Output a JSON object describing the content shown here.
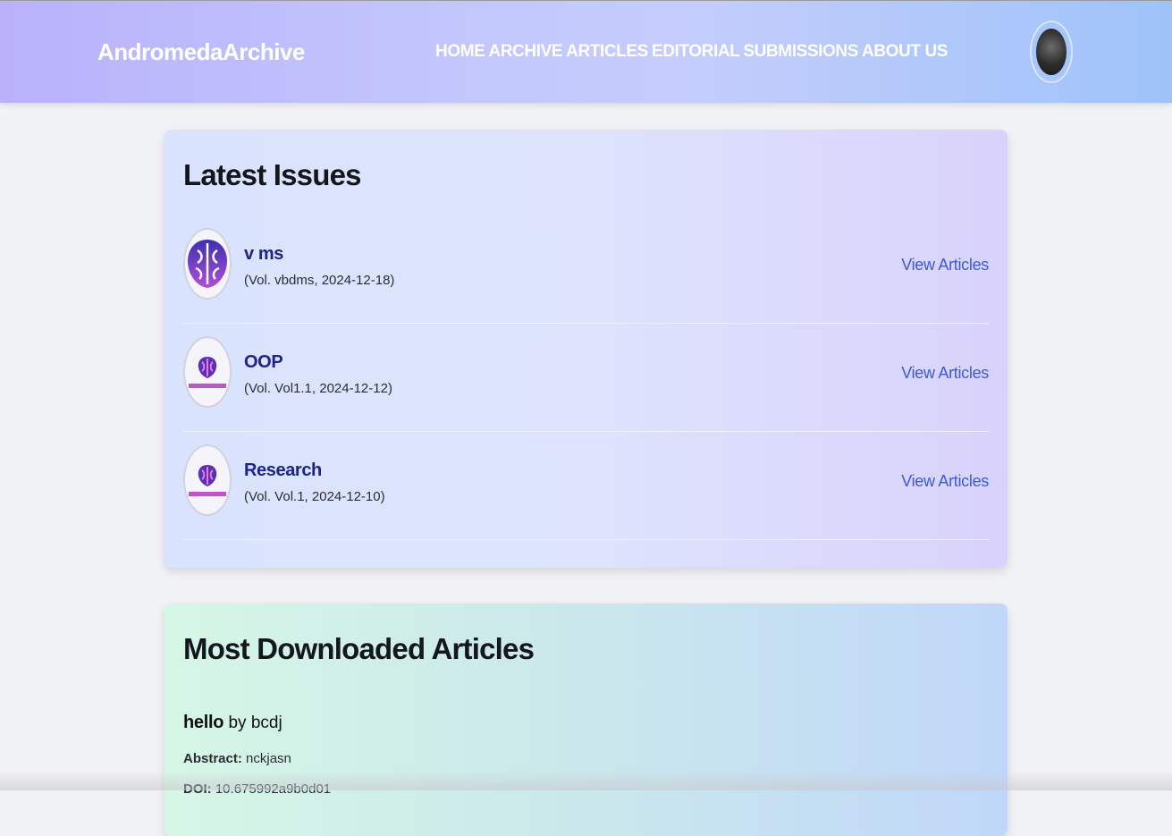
{
  "header": {
    "brand": "AndromedaArchive",
    "nav": [
      "HOME",
      "ARCHIVE",
      "ARTICLES",
      "EDITORIAL",
      "SUBMISSIONS",
      "ABOUT US"
    ],
    "avatar_icon": "user-avatar"
  },
  "latest_issues": {
    "title": "Latest Issues",
    "items": [
      {
        "name": "v ms",
        "meta": "(Vol. vbdms, 2024-12-18)",
        "link": "View Articles",
        "logo": "brain-logo-purple"
      },
      {
        "name": "OOP",
        "meta": "(Vol. Vol1.1, 2024-12-12)",
        "link": "View Articles",
        "logo": "fertilisense-logo"
      },
      {
        "name": "Research",
        "meta": "(Vol. Vol.1, 2024-12-10)",
        "link": "View Articles",
        "logo": "fertilisense-logo"
      }
    ]
  },
  "most_downloaded": {
    "title": "Most Downloaded Articles",
    "articles": [
      {
        "title": "hello",
        "by_label": "by",
        "author": "bcdj",
        "abstract_label": "Abstract:",
        "abstract": "nckjasn",
        "doi_label": "DOI:",
        "doi": "10.675992a9b0d01"
      }
    ]
  },
  "colors": {
    "link": "#3b5bd6",
    "issue_title": "#1c2389",
    "header_gradient_start": "#b9b2fb",
    "header_gradient_end": "#9ec3f9"
  }
}
